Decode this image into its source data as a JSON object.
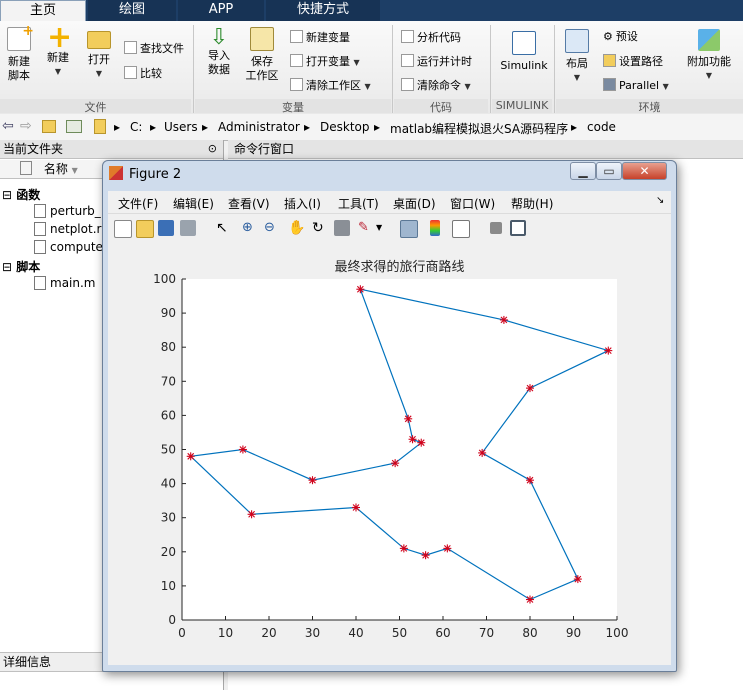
{
  "tabs": [
    "主页",
    "绘图",
    "APP",
    "快捷方式"
  ],
  "ribbon": {
    "file": {
      "new_script": "新建\n脚本",
      "new": "新建",
      "open": "打开",
      "find_files": "查找文件",
      "compare": "比较",
      "group": "文件"
    },
    "variable": {
      "import": "导入\n数据",
      "save_ws": "保存\n工作区",
      "new_var": "新建变量",
      "open_var": "打开变量",
      "clear_ws": "清除工作区",
      "group": "变量"
    },
    "code": {
      "analyze": "分析代码",
      "run_time": "运行并计时",
      "clear_cmd": "清除命令",
      "group": "代码"
    },
    "simulink": {
      "label": "Simulink",
      "group": "SIMULINK"
    },
    "env": {
      "layout": "布局",
      "prefs": "预设",
      "set_path": "设置路径",
      "parallel": "Parallel",
      "addons": "附加功能",
      "group": "环境"
    }
  },
  "address": {
    "crumbs": [
      "C:",
      "Users",
      "Administrator",
      "Desktop",
      "matlab编程模拟退火SA源码程序",
      "code"
    ]
  },
  "left_panel": {
    "title": "当前文件夹",
    "col_name": "名称",
    "functions_label": "函数",
    "functions": [
      "perturb_",
      "netplot.r",
      "compute"
    ],
    "scripts_label": "脚本",
    "scripts": [
      "main.m"
    ],
    "details": "详细信息"
  },
  "command_window": {
    "title": "命令行窗口"
  },
  "figure": {
    "title": "Figure 2",
    "menu": [
      "文件(F)",
      "编辑(E)",
      "查看(V)",
      "插入(I)",
      "工具(T)",
      "桌面(D)",
      "窗口(W)",
      "帮助(H)"
    ],
    "toolbar_icons": [
      "new-figure-icon",
      "open-icon",
      "save-icon",
      "print-icon",
      "pointer-icon",
      "zoom-in-icon",
      "zoom-out-icon",
      "pan-icon",
      "rotate-icon",
      "data-cursor-icon",
      "brush-icon",
      "link-icon",
      "colorbar-icon",
      "legend-icon",
      "hide-plot-tools-icon",
      "show-plot-tools-icon"
    ]
  },
  "chart_data": {
    "type": "line",
    "title": "最终求得的旅行商路线",
    "xlim": [
      0,
      100
    ],
    "ylim": [
      0,
      100
    ],
    "xticks": [
      0,
      10,
      20,
      30,
      40,
      50,
      60,
      70,
      80,
      90,
      100
    ],
    "yticks": [
      0,
      10,
      20,
      30,
      40,
      50,
      60,
      70,
      80,
      90,
      100
    ],
    "grid": false,
    "line_color": "#0072bd",
    "marker_color": "#d0021b",
    "marker": "*",
    "route": [
      [
        41,
        97
      ],
      [
        74,
        88
      ],
      [
        98,
        79
      ],
      [
        80,
        68
      ],
      [
        69,
        49
      ],
      [
        80,
        41
      ],
      [
        91,
        12
      ],
      [
        80,
        6
      ],
      [
        61,
        21
      ],
      [
        56,
        19
      ],
      [
        51,
        21
      ],
      [
        40,
        33
      ],
      [
        16,
        31
      ],
      [
        2,
        48
      ],
      [
        14,
        50
      ],
      [
        30,
        41
      ],
      [
        49,
        46
      ],
      [
        55,
        52
      ],
      [
        53,
        53
      ],
      [
        52,
        59
      ],
      [
        41,
        97
      ]
    ]
  }
}
